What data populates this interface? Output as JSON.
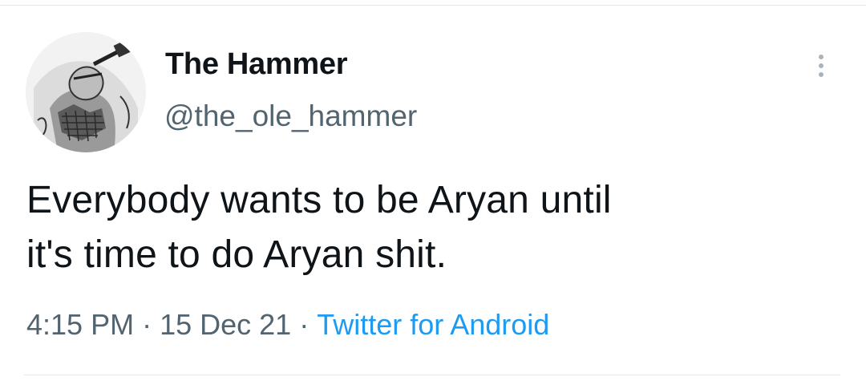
{
  "author": {
    "display_name": "The Hammer",
    "handle": "@the_ole_hammer",
    "avatar_icon": "hammer-wielding-warrior-sketch"
  },
  "tweet": {
    "text_line_1": "Everybody wants to be Aryan until",
    "text_line_2": "it's time to do Aryan shit."
  },
  "meta": {
    "time": "4:15 PM",
    "separator": "·",
    "date": "15 Dec 21",
    "source": "Twitter for Android"
  },
  "colors": {
    "text_primary": "#0f1419",
    "text_secondary": "#536471",
    "link": "#1d9bf0",
    "divider": "#e6e8ea"
  }
}
